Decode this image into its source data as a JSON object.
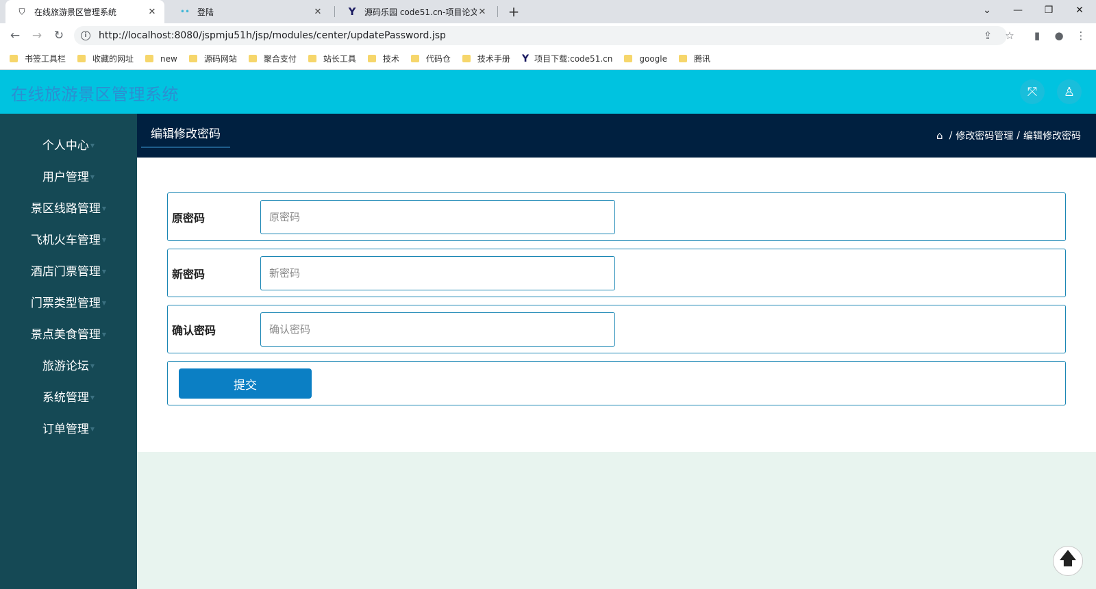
{
  "browser": {
    "tabs": [
      {
        "title": "在线旅游景区管理系统",
        "icon": "shield-icon",
        "active": true
      },
      {
        "title": "登陆",
        "icon": "dots-icon",
        "active": false
      },
      {
        "title": "源码乐园 code51.cn-项目论文代",
        "icon": "y-logo-icon",
        "active": false
      }
    ],
    "new_tab": "+",
    "url": "http://localhost:8080/jspmju51h/jsp/modules/center/updatePassword.jsp",
    "bookmarks": [
      "书签工具栏",
      "收藏的网址",
      "new",
      "源码网站",
      "聚合支付",
      "站长工具",
      "技术",
      "代码仓",
      "技术手册",
      "项目下载:code51.cn",
      "google",
      "腾讯"
    ]
  },
  "app": {
    "title": "在线旅游景区管理系统",
    "accent_color": "#00c3e0",
    "sidebar_color": "#154955"
  },
  "sidebar": {
    "items": [
      {
        "label": "个人中心"
      },
      {
        "label": "用户管理"
      },
      {
        "label": "景区线路管理"
      },
      {
        "label": "飞机火车管理"
      },
      {
        "label": "酒店门票管理"
      },
      {
        "label": "门票类型管理"
      },
      {
        "label": "景点美食管理"
      },
      {
        "label": "旅游论坛"
      },
      {
        "label": "系统管理"
      },
      {
        "label": "订单管理"
      }
    ]
  },
  "page": {
    "title": "编辑修改密码",
    "breadcrumb": [
      "修改密码管理",
      "编辑修改密码"
    ]
  },
  "form": {
    "old_password": {
      "label": "原密码",
      "placeholder": "原密码",
      "value": ""
    },
    "new_password": {
      "label": "新密码",
      "placeholder": "新密码",
      "value": ""
    },
    "confirm_password": {
      "label": "确认密码",
      "placeholder": "确认密码",
      "value": ""
    },
    "submit_label": "提交"
  }
}
